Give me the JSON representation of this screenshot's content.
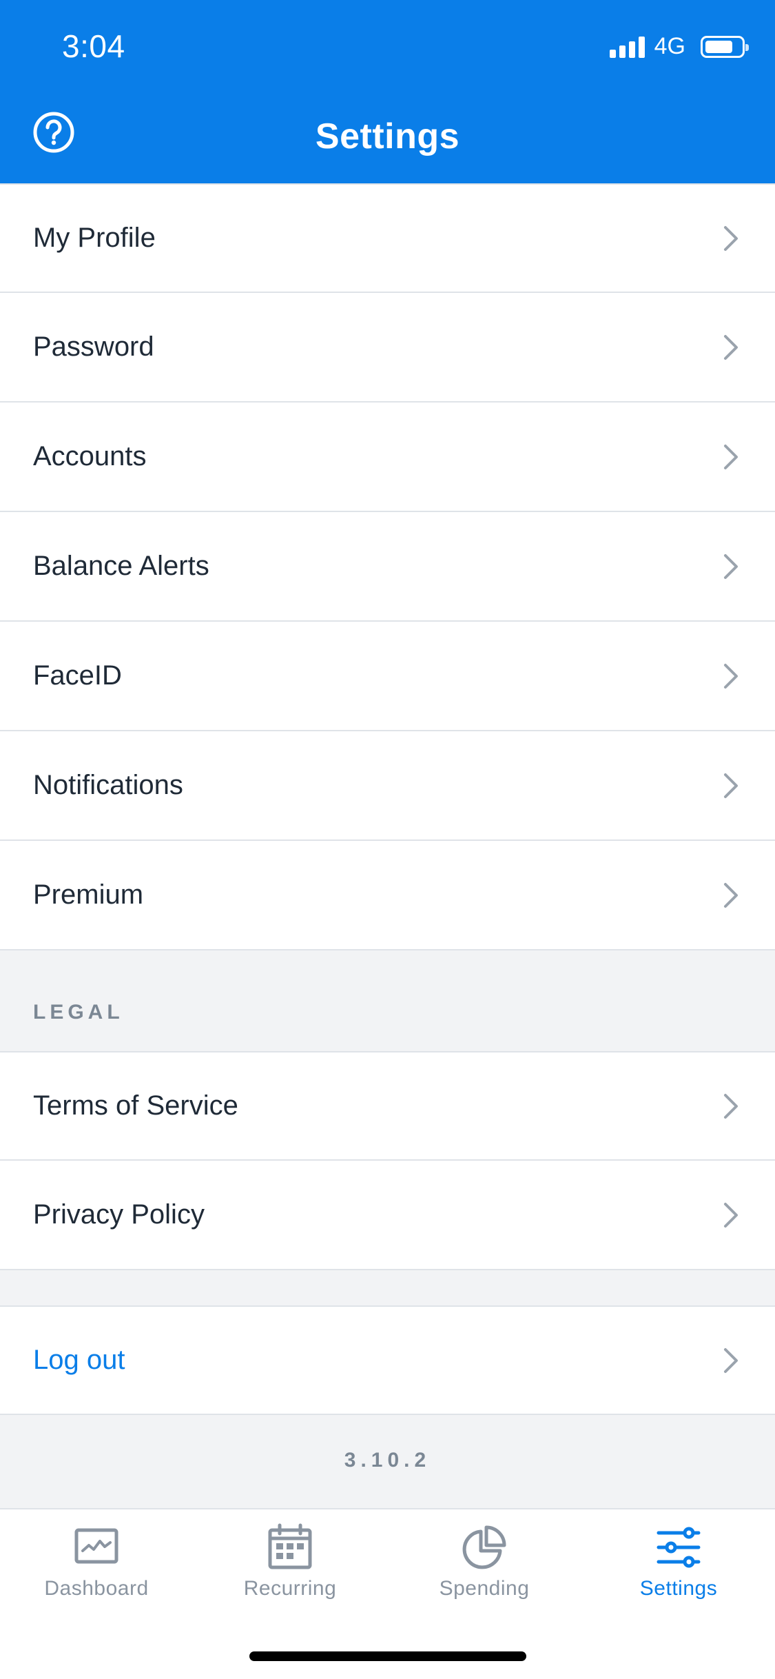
{
  "status_bar": {
    "time": "3:04",
    "network": "4G",
    "battery_level": 0.78
  },
  "header": {
    "title": "Settings",
    "help_icon": "question-circle-icon"
  },
  "settings_items": [
    {
      "label": "My Profile"
    },
    {
      "label": "Password"
    },
    {
      "label": "Accounts"
    },
    {
      "label": "Balance Alerts"
    },
    {
      "label": "FaceID"
    },
    {
      "label": "Notifications"
    },
    {
      "label": "Premium"
    }
  ],
  "legal": {
    "header": "LEGAL",
    "items": [
      {
        "label": "Terms of Service"
      },
      {
        "label": "Privacy Policy"
      }
    ]
  },
  "logout": {
    "label": "Log out"
  },
  "version": "3.10.2",
  "tabs": [
    {
      "label": "Dashboard",
      "icon": "dashboard-chart-icon",
      "active": false
    },
    {
      "label": "Recurring",
      "icon": "calendar-icon",
      "active": false
    },
    {
      "label": "Spending",
      "icon": "pie-chart-icon",
      "active": false
    },
    {
      "label": "Settings",
      "icon": "sliders-icon",
      "active": true
    }
  ],
  "colors": {
    "accent": "#0a7ee8",
    "text": "#1f2a37",
    "muted": "#8a94a0",
    "background": "#f2f3f5"
  }
}
